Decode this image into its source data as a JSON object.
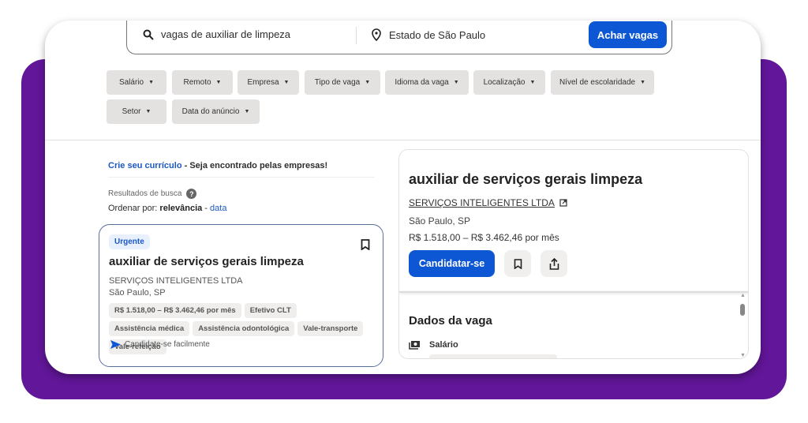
{
  "search": {
    "query": "vagas de auxiliar de limpeza",
    "location": "Estado de São Paulo",
    "button": "Achar vagas"
  },
  "filters": [
    "Salário",
    "Remoto",
    "Empresa",
    "Tipo de vaga",
    "Idioma da vaga",
    "Localização",
    "Nível de escolaridade",
    "Setor",
    "Data do anúncio"
  ],
  "promo": {
    "link": "Crie seu currículo",
    "text": " - Seja encontrado pelas empresas!"
  },
  "results": {
    "label": "Resultados de busca",
    "order_prefix": "Ordenar por: ",
    "order_active": "relevância",
    "order_sep": " - ",
    "order_alt": "data"
  },
  "job": {
    "badge": "Urgente",
    "title": "auxiliar de serviços gerais limpeza",
    "company": "SERVIÇOS INTELIGENTES LTDA",
    "location": "São Paulo, SP",
    "tags": [
      "R$ 1.518,00 – R$ 3.462,46 por mês",
      "Efetivo CLT",
      "Assistência médica",
      "Assistência odontológica",
      "Vale-transporte",
      "Vale-refeição"
    ],
    "easy_apply": "Candidate-se facilmente"
  },
  "detail": {
    "title": "auxiliar de serviços gerais limpeza",
    "company": "SERVIÇOS INTELIGENTES LTDA",
    "location": "São Paulo, SP",
    "salary": "R$ 1.518,00 – R$ 3.462,46 por mês",
    "apply": "Candidatar-se",
    "section": "Dados da vaga",
    "salary_label": "Salário"
  },
  "colors": {
    "accent": "#0d57d4",
    "purple": "#621699"
  }
}
